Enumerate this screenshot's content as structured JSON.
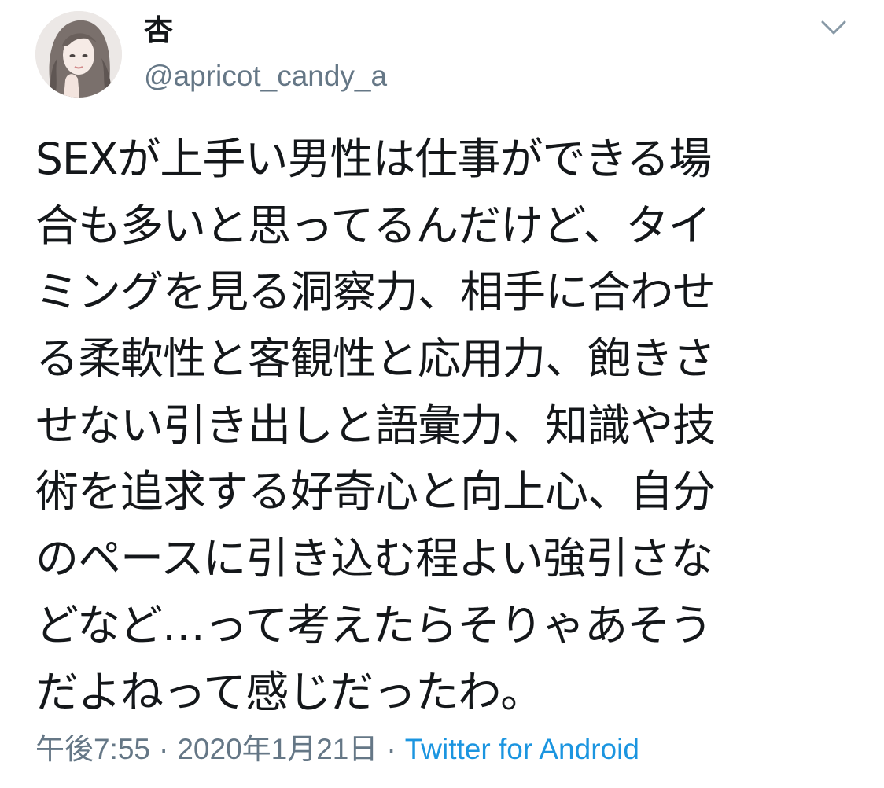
{
  "user": {
    "display_name": "杏",
    "handle": "@apricot_candy_a",
    "avatar_icon": "user-avatar"
  },
  "menu": {
    "icon": "chevron-down-icon"
  },
  "tweet": {
    "lines": [
      "SEXが上手い男性は仕事ができる場",
      "合も多いと思ってるんだけど、タイ",
      "ミングを見る洞察力、相手に合わせ",
      "る柔軟性と客観性と応用力、飽きさ",
      "せない引き出しと語彙力、知識や技",
      "術を追求する好奇心と向上心、自分",
      "のペースに引き込む程よい強引さな",
      "どなど…って考えたらそりゃあそう",
      "だよねって感じだったわ。"
    ]
  },
  "meta": {
    "time": "午後7:55",
    "separator": "·",
    "date": "2020年1月21日",
    "source": "Twitter for Android"
  },
  "colors": {
    "text": "#14171a",
    "secondary": "#657786",
    "link": "#1b95e0"
  }
}
